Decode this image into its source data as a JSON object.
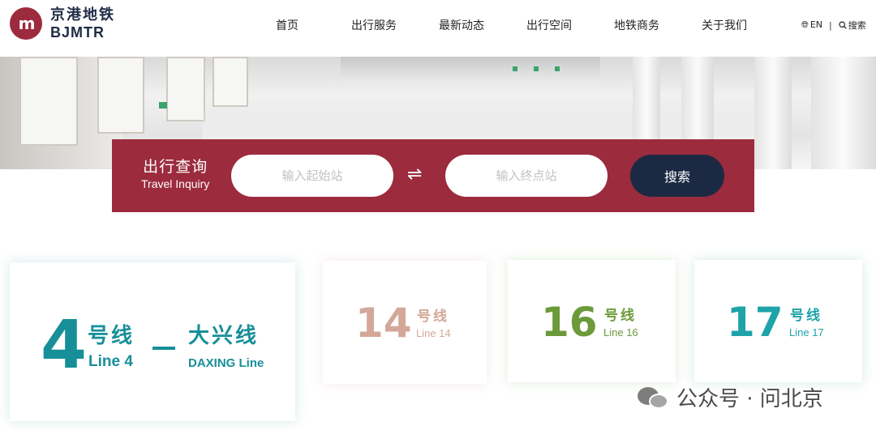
{
  "header": {
    "logo_mark": "m",
    "logo_cn": "京港地铁",
    "logo_en": "BJMTR",
    "nav": [
      "首页",
      "出行服务",
      "最新动态",
      "出行空间",
      "地铁商务",
      "关于我们"
    ],
    "lang_label": "EN",
    "search_label": "搜索",
    "lang_icon": "globe-icon",
    "search_icon": "search-icon"
  },
  "trip_search": {
    "title_cn": "出行查询",
    "title_en": "Travel Inquiry",
    "from_placeholder": "输入起始站",
    "to_placeholder": "输入终点站",
    "swap_icon": "swap-arrows-icon",
    "submit_label": "搜索",
    "accent_color": "#9c2b3e",
    "button_color": "#1c2942"
  },
  "lines": [
    {
      "number": "4",
      "cn": "号线",
      "en": "Line 4",
      "extra_cn": "大兴线",
      "extra_en": "DAXING Line",
      "color": "#178f99"
    },
    {
      "number": "14",
      "cn": "号线",
      "en": "Line 14",
      "color": "#d3a898"
    },
    {
      "number": "16",
      "cn": "号线",
      "en": "Line 16",
      "color": "#6b9a3a"
    },
    {
      "number": "17",
      "cn": "号线",
      "en": "Line 17",
      "color": "#1da3a8"
    }
  ],
  "watermark": {
    "text": "公众号 · 问北京",
    "icon": "wechat-icon"
  }
}
